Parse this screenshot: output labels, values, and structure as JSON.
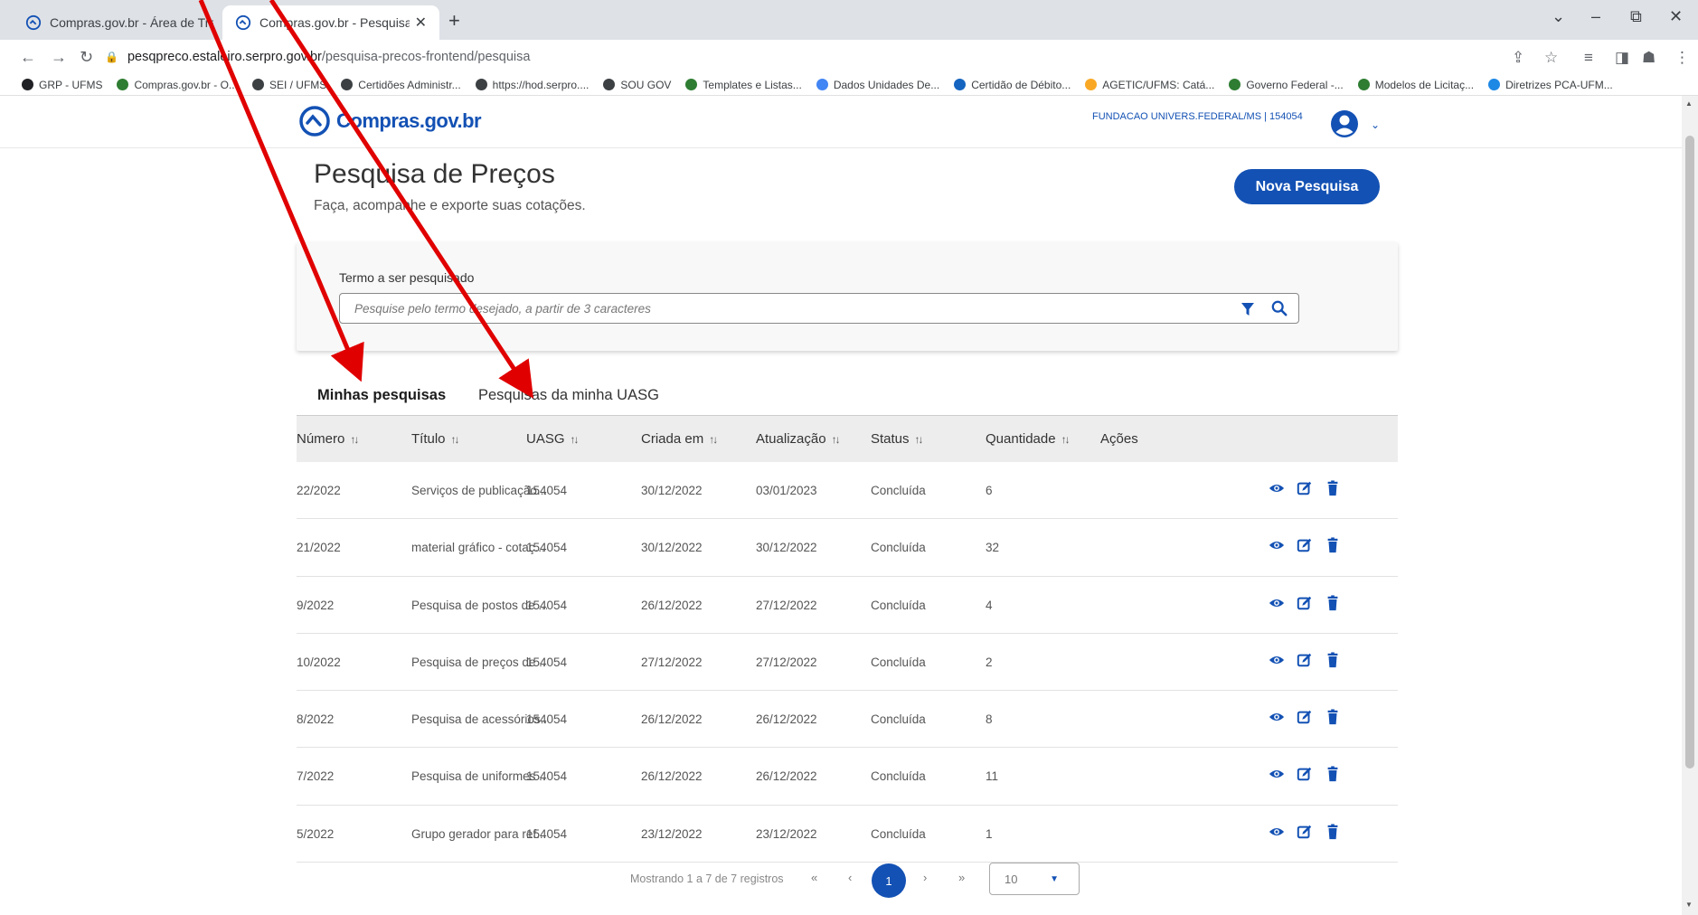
{
  "browser": {
    "tabs": [
      {
        "label": "Compras.gov.br - Área de Trabalho"
      },
      {
        "label": "Compras.gov.br - Pesquisa de Preços",
        "close": "✕"
      }
    ],
    "new_tab": "+",
    "window_controls": [
      "⌄",
      "–",
      "⧉",
      "✕"
    ],
    "address": {
      "host": "pesqpreco.estaleiro.serpro.gov.br",
      "path": "/pesquisa-precos-frontend/pesquisa"
    },
    "bookmarks": [
      {
        "label": "GRP - UFMS",
        "icon": "graduation-cap-icon",
        "color": "#202124"
      },
      {
        "label": "Compras.gov.br - O...",
        "icon": "compras-icon",
        "color": "#2e7d32"
      },
      {
        "label": "SEI / UFMS",
        "icon": "globe-icon",
        "color": "#3c4043"
      },
      {
        "label": "Certidões Administr...",
        "icon": "certidao-icon",
        "color": "#3c4043"
      },
      {
        "label": "https://hod.serpro....",
        "icon": "globe-icon",
        "color": "#3c4043"
      },
      {
        "label": "SOU GOV",
        "icon": "globe-icon",
        "color": "#3c4043"
      },
      {
        "label": "Templates e Listas...",
        "icon": "compras-icon",
        "color": "#2e7d32"
      },
      {
        "label": "Dados Unidades De...",
        "icon": "google-icon",
        "color": "#4285f4"
      },
      {
        "label": "Certidão de Débito...",
        "icon": "receita-icon",
        "color": "#1565c0"
      },
      {
        "label": "AGETIC/UFMS: Catá...",
        "icon": "building-icon",
        "color": "#f9a825"
      },
      {
        "label": "Governo Federal -...",
        "icon": "compras-icon",
        "color": "#2e7d32"
      },
      {
        "label": "Modelos de Licitaç...",
        "icon": "compras-icon",
        "color": "#2e7d32"
      },
      {
        "label": "Diretrizes PCA-UFM...",
        "icon": "doc-icon",
        "color": "#1e88e5"
      }
    ]
  },
  "header": {
    "logo_text": "Compras.gov.br",
    "org": "FUNDACAO UNIVERS.FEDERAL/MS | 154054"
  },
  "page": {
    "title": "Pesquisa de Preços",
    "subtitle": "Faça, acompanhe e exporte suas cotações.",
    "new_button": "Nova Pesquisa"
  },
  "search": {
    "label": "Termo a ser pesquisado",
    "placeholder": "Pesquise pelo termo desejado, a partir de 3 caracteres"
  },
  "tabs": [
    {
      "label": "Minhas pesquisas",
      "active": true
    },
    {
      "label": "Pesquisas da minha UASG",
      "active": false
    }
  ],
  "table": {
    "columns": [
      "Número",
      "Título",
      "UASG",
      "Criada em",
      "Atualização",
      "Status",
      "Quantidade",
      "Ações"
    ],
    "sort_glyph": "↑↓",
    "rows": [
      {
        "numero": "22/2022",
        "titulo": "Serviços de publicação...",
        "uasg": "154054",
        "criada": "30/12/2022",
        "atualizacao": "03/01/2023",
        "status": "Concluída",
        "quantidade": "6"
      },
      {
        "numero": "21/2022",
        "titulo": "material gráfico - cotaç...",
        "uasg": "154054",
        "criada": "30/12/2022",
        "atualizacao": "30/12/2022",
        "status": "Concluída",
        "quantidade": "32"
      },
      {
        "numero": "9/2022",
        "titulo": "Pesquisa de postos de ...",
        "uasg": "154054",
        "criada": "26/12/2022",
        "atualizacao": "27/12/2022",
        "status": "Concluída",
        "quantidade": "4"
      },
      {
        "numero": "10/2022",
        "titulo": "Pesquisa de preços de ...",
        "uasg": "154054",
        "criada": "27/12/2022",
        "atualizacao": "27/12/2022",
        "status": "Concluída",
        "quantidade": "2"
      },
      {
        "numero": "8/2022",
        "titulo": "Pesquisa de acessórios...",
        "uasg": "154054",
        "criada": "26/12/2022",
        "atualizacao": "26/12/2022",
        "status": "Concluída",
        "quantidade": "8"
      },
      {
        "numero": "7/2022",
        "titulo": "Pesquisa de uniformes ...",
        "uasg": "154054",
        "criada": "26/12/2022",
        "atualizacao": "26/12/2022",
        "status": "Concluída",
        "quantidade": "11"
      },
      {
        "numero": "5/2022",
        "titulo": "Grupo gerador para ref...",
        "uasg": "154054",
        "criada": "23/12/2022",
        "atualizacao": "23/12/2022",
        "status": "Concluída",
        "quantidade": "1"
      }
    ]
  },
  "pagination": {
    "info": "Mostrando 1 a 7 de 7 registros",
    "first": "«",
    "prev": "‹",
    "current": "1",
    "next": "›",
    "last": "»",
    "page_size": "10"
  },
  "colors": {
    "brand": "#1351b4",
    "annotation_arrow": "#e00000"
  }
}
